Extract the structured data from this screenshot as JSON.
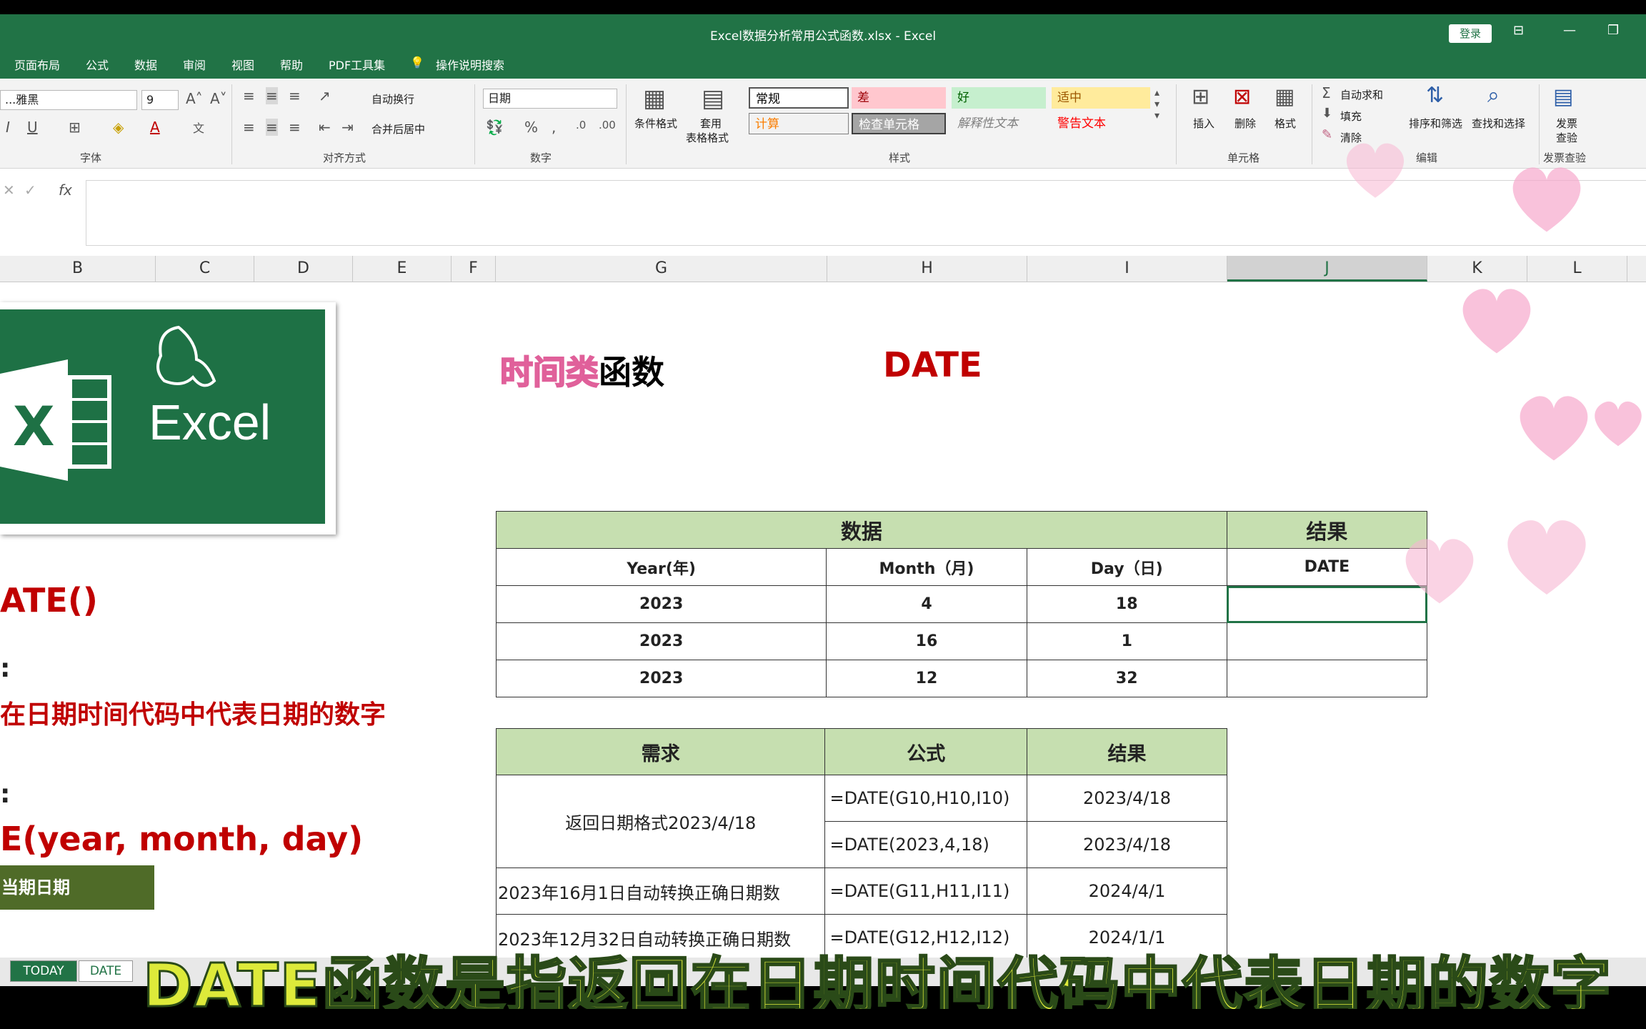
{
  "window": {
    "title": "Excel数据分析常用公式函数.xlsx  -  Excel",
    "login_label": "登录",
    "menu": [
      "页面布局",
      "公式",
      "数据",
      "审阅",
      "视图",
      "帮助",
      "PDF工具集"
    ],
    "tell_me": "操作说明搜索"
  },
  "ribbon": {
    "font_name": "...雅黑",
    "font_size": "9",
    "wrap_text": "自动换行",
    "merge_center": "合并后居中",
    "number_format": "日期",
    "conditional_format": "条件格式",
    "table_format_1": "套用",
    "table_format_2": "表格格式",
    "styles": [
      "常规",
      "差",
      "好",
      "适中",
      "计算",
      "检查单元格",
      "解释性文本",
      "警告文本"
    ],
    "insert": "插入",
    "delete": "删除",
    "format": "格式",
    "autosum": "自动求和",
    "fill": "填充",
    "clear": "清除",
    "sort_filter": "排序和筛选",
    "find_select": "查找和选择",
    "invoice_1": "发票",
    "invoice_2": "查验",
    "groups": {
      "font": "字体",
      "alignment": "对齐方式",
      "number": "数字",
      "styles": "样式",
      "cells": "单元格",
      "editing": "编辑",
      "invoice": "发票查验"
    }
  },
  "formula_bar": {
    "fx": "fx",
    "value": ""
  },
  "columns": [
    "B",
    "C",
    "D",
    "E",
    "F",
    "G",
    "H",
    "I",
    "J",
    "K",
    "L"
  ],
  "sheet": {
    "heading_category": "时间类",
    "heading_suffix": "函数",
    "heading_func": "DATE",
    "left_func": "ATE()",
    "left_colon1": ":",
    "left_desc": "在日期时间代码中代表日期的数字",
    "left_colon2": ":",
    "left_syntax": "E(year, month, day)",
    "left_button": "当期日期",
    "logo_text": "Excel"
  },
  "data_table": {
    "header_data": "数据",
    "header_result": "结果",
    "columns": [
      "Year(年)",
      "Month（月)",
      "Day（日)",
      "DATE"
    ],
    "rows": [
      [
        "2023",
        "4",
        "18",
        ""
      ],
      [
        "2023",
        "16",
        "1",
        ""
      ],
      [
        "2023",
        "12",
        "32",
        ""
      ]
    ]
  },
  "req_table": {
    "headers": [
      "需求",
      "公式",
      "结果"
    ],
    "row1_req": "返回日期格式2023/4/18",
    "row1a_formula": "=DATE(G10,H10,I10)",
    "row1a_result": "2023/4/18",
    "row1b_formula": "=DATE(2023,4,18)",
    "row1b_result": "2023/4/18",
    "row2_req": "2023年16月1日自动转换正确日期数",
    "row2_formula": "=DATE(G11,H11,I11)",
    "row2_result": "2024/4/1",
    "row3_req": "2023年12月32日自动转换正确日期数",
    "row3_formula": "=DATE(G12,H12,I12)",
    "row3_result": "2024/1/1"
  },
  "tabs": [
    "TODAY",
    "DATE"
  ],
  "subtitle": "DATE函数是指返回在日期时间代码中代表日期的数字",
  "colors": {
    "excel_green": "#217346",
    "header_fill": "#c6dfb0",
    "accent_red": "#c00000"
  }
}
